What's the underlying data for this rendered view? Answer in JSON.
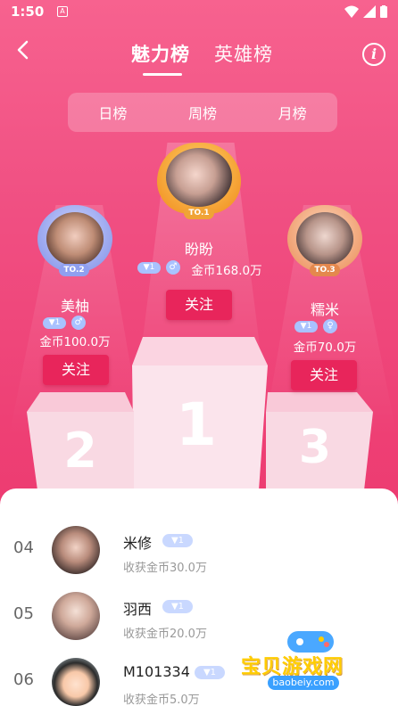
{
  "status_bar": {
    "time": "1:50",
    "notification_glyph": "A"
  },
  "header": {
    "tabs": [
      {
        "label": "魅力榜",
        "active": true
      },
      {
        "label": "英雄榜",
        "active": false
      }
    ],
    "info_label": "i"
  },
  "period_tabs": [
    "日榜",
    "周榜",
    "月榜"
  ],
  "podium": {
    "first": {
      "rank_tag": "TO.1",
      "name": "盼盼",
      "level": "1",
      "gender_icon": "male-icon",
      "coins": "金币168.0万",
      "follow_label": "关注",
      "podium_number": "1"
    },
    "second": {
      "rank_tag": "TO.2",
      "name": "美柚",
      "level": "1",
      "gender_icon": "male-icon",
      "coins": "金币100.0万",
      "follow_label": "关注",
      "podium_number": "2"
    },
    "third": {
      "rank_tag": "TO.3",
      "name": "糯米",
      "level": "1",
      "gender_icon": "female-icon",
      "coins": "金币70.0万",
      "follow_label": "关注",
      "podium_number": "3"
    }
  },
  "ranking_list": [
    {
      "rank": "04",
      "name": "米修",
      "level": "1",
      "coins": "收获金币30.0万"
    },
    {
      "rank": "05",
      "name": "羽西",
      "level": "1",
      "coins": "收获金币20.0万"
    },
    {
      "rank": "06",
      "name": "M101334",
      "level": "1",
      "coins": "收获金币5.0万"
    }
  ],
  "watermark": {
    "title": "宝贝游戏网",
    "url": "baobeiy.com"
  },
  "colors": {
    "background": "#f04f82",
    "follow_button": "#e8255b",
    "gold_frame": "#f3a93a",
    "silver_frame": "#9aa8ff",
    "bronze_frame": "#f0a87a",
    "level_badge": "#a9c2ff"
  }
}
